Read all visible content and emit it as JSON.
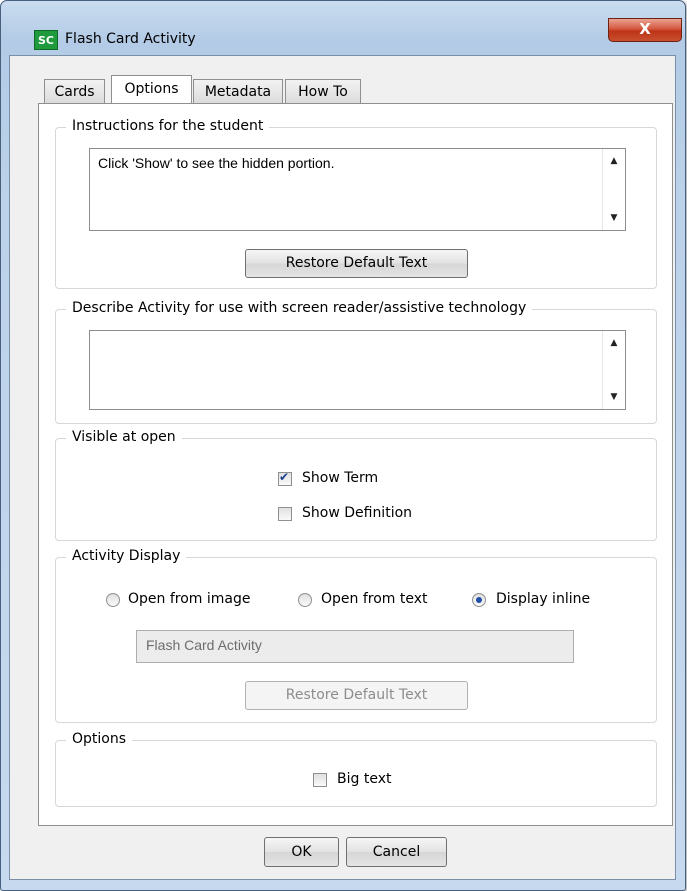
{
  "window": {
    "app_icon_text": "SC",
    "title": "Flash Card Activity",
    "close_glyph": "X"
  },
  "tabs": [
    {
      "label": "Cards"
    },
    {
      "label": "Options",
      "active": true
    },
    {
      "label": "Metadata"
    },
    {
      "label": "How To"
    }
  ],
  "instructions": {
    "legend": "Instructions for the student",
    "value": "Click 'Show' to see the hidden portion.",
    "restore_label": "Restore Default Text"
  },
  "describe": {
    "legend": "Describe Activity for use with screen reader/assistive technology",
    "value": ""
  },
  "visible_at_open": {
    "legend": "Visible at open",
    "show_term": {
      "label": "Show Term",
      "checked": true
    },
    "show_definition": {
      "label": "Show Definition",
      "checked": false
    }
  },
  "activity_display": {
    "legend": "Activity Display",
    "options": [
      {
        "label": "Open from image",
        "selected": false
      },
      {
        "label": "Open from text",
        "selected": false
      },
      {
        "label": "Display inline",
        "selected": true
      }
    ],
    "title_value": "Flash Card Activity",
    "restore_label": "Restore Default Text"
  },
  "options_group": {
    "legend": "Options",
    "big_text": {
      "label": "Big text",
      "checked": false
    }
  },
  "footer": {
    "ok_label": "OK",
    "cancel_label": "Cancel"
  },
  "scroll_icons": {
    "up": "▲",
    "down": "▼"
  }
}
